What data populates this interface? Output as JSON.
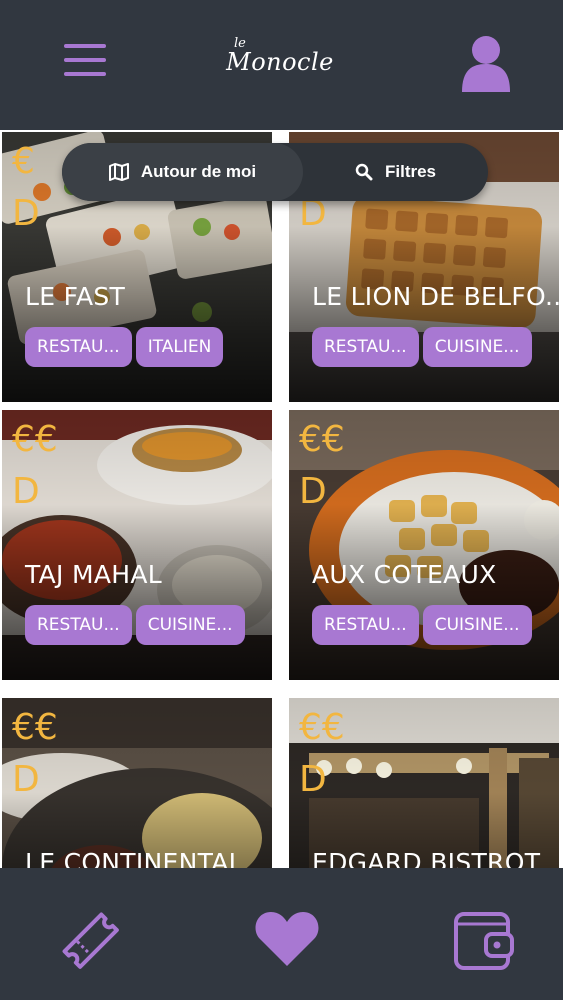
{
  "header": {
    "logo_small": "le",
    "logo_main": "Monocle",
    "menu_icon": "hamburger-menu-icon",
    "user_icon": "user-profile-icon"
  },
  "filters": {
    "nearby_label": "Autour de moi",
    "nearby_icon": "map-icon",
    "filters_label": "Filtres",
    "filters_icon": "search-icon"
  },
  "restaurants": [
    {
      "price": "€",
      "price_suffix": "D",
      "name": "LE FAST",
      "tags": [
        "RESTAU...",
        "ITALIEN"
      ]
    },
    {
      "price": "€",
      "price_suffix": "D",
      "name": "LE LION DE BELFO...",
      "tags": [
        "RESTAU...",
        "CUISINE..."
      ]
    },
    {
      "price": "€€",
      "price_suffix": "D",
      "name": "TAJ MAHAL",
      "tags": [
        "RESTAU...",
        "CUISINE..."
      ]
    },
    {
      "price": "€€",
      "price_suffix": "D",
      "name": "AUX COTEAUX",
      "tags": [
        "RESTAU...",
        "CUISINE..."
      ]
    },
    {
      "price": "€€",
      "price_suffix": "D",
      "name": "LE CONTINENTAL",
      "tags": []
    },
    {
      "price": "€€",
      "price_suffix": "D",
      "name": "EDGARD BISTROT",
      "tags": []
    }
  ],
  "bottom_nav": {
    "tickets_icon": "ticket-icon",
    "favorites_icon": "heart-icon",
    "wallet_icon": "wallet-icon"
  },
  "colors": {
    "bar_bg": "#313740",
    "accent_purple": "#a878d2",
    "price_gold": "#f2b640"
  }
}
